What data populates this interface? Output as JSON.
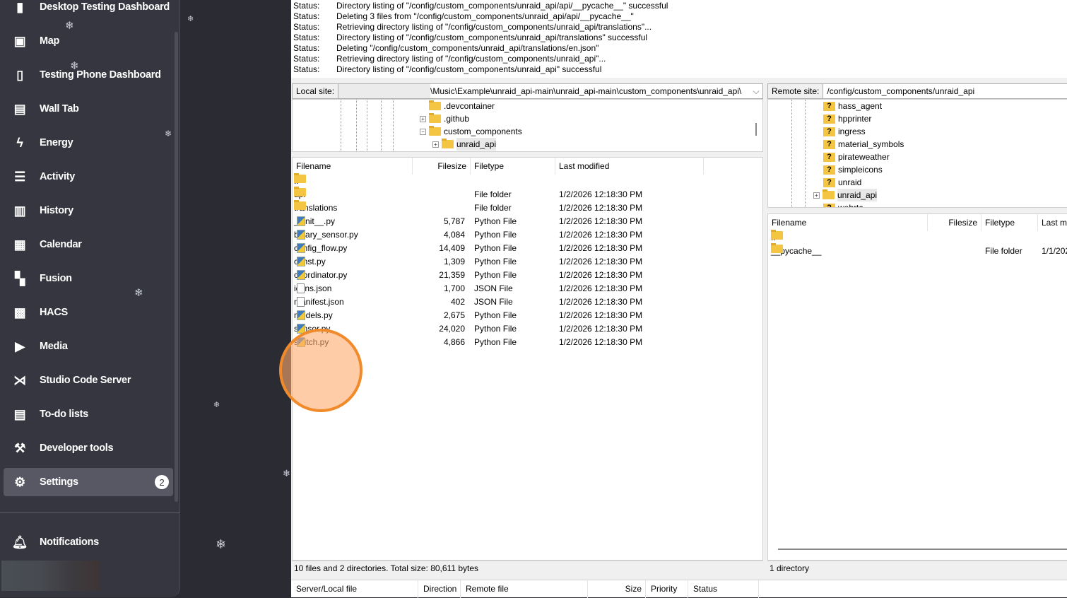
{
  "sidebar": {
    "items": [
      {
        "label": "Desktop Testing Dashboard",
        "icon": "test-tube-icon"
      },
      {
        "label": "Map",
        "icon": "map-account-icon"
      },
      {
        "label": "Testing Phone Dashboard",
        "icon": "phone-icon"
      },
      {
        "label": "Wall Tab",
        "icon": "newspaper-icon"
      },
      {
        "label": "Energy",
        "icon": "lightning-icon"
      },
      {
        "label": "Activity",
        "icon": "list-icon"
      },
      {
        "label": "History",
        "icon": "chart-box-icon"
      },
      {
        "label": "Calendar",
        "icon": "calendar-icon"
      },
      {
        "label": "Fusion",
        "icon": "dashboard-icon"
      },
      {
        "label": "HACS",
        "icon": "hacs-store-icon"
      },
      {
        "label": "Media",
        "icon": "play-box-icon"
      },
      {
        "label": "Studio Code Server",
        "icon": "vscode-icon"
      },
      {
        "label": "To-do lists",
        "icon": "clipboard-list-icon"
      },
      {
        "label": "Developer tools",
        "icon": "hammer-icon"
      },
      {
        "label": "Settings",
        "icon": "gear-icon",
        "badge": "2"
      }
    ],
    "notifications": "Notifications"
  },
  "log": [
    {
      "k": "Status:",
      "v": "Directory listing of \"/config/custom_components/unraid_api/api/__pycache__\" successful"
    },
    {
      "k": "Status:",
      "v": "Deleting 3 files from \"/config/custom_components/unraid_api/api/__pycache__\""
    },
    {
      "k": "Status:",
      "v": "Retrieving directory listing of \"/config/custom_components/unraid_api/translations\"..."
    },
    {
      "k": "Status:",
      "v": "Directory listing of \"/config/custom_components/unraid_api/translations\" successful"
    },
    {
      "k": "Status:",
      "v": "Deleting \"/config/custom_components/unraid_api/translations/en.json\""
    },
    {
      "k": "Status:",
      "v": "Retrieving directory listing of \"/config/custom_components/unraid_api\"..."
    },
    {
      "k": "Status:",
      "v": "Directory listing of \"/config/custom_components/unraid_api\" successful"
    }
  ],
  "local": {
    "label": "Local site:",
    "path": "\\Music\\Example\\unraid_api-main\\unraid_api-main\\custom_components\\unraid_api\\",
    "tree": [
      ".devcontainer",
      ".github",
      "custom_components",
      "unraid_api"
    ],
    "headers": [
      "Filename",
      "Filesize",
      "Filetype",
      "Last modified"
    ],
    "files": [
      {
        "name": "..",
        "size": "",
        "type": "",
        "mod": "",
        "kind": "folder"
      },
      {
        "name": "api",
        "size": "",
        "type": "File folder",
        "mod": "1/2/2026 12:18:30 PM",
        "kind": "folder"
      },
      {
        "name": "translations",
        "size": "",
        "type": "File folder",
        "mod": "1/2/2026 12:18:30 PM",
        "kind": "folder"
      },
      {
        "name": "__init__.py",
        "size": "5,787",
        "type": "Python File",
        "mod": "1/2/2026 12:18:30 PM",
        "kind": "py"
      },
      {
        "name": "binary_sensor.py",
        "size": "4,084",
        "type": "Python File",
        "mod": "1/2/2026 12:18:30 PM",
        "kind": "py"
      },
      {
        "name": "config_flow.py",
        "size": "14,409",
        "type": "Python File",
        "mod": "1/2/2026 12:18:30 PM",
        "kind": "py"
      },
      {
        "name": "const.py",
        "size": "1,309",
        "type": "Python File",
        "mod": "1/2/2026 12:18:30 PM",
        "kind": "py"
      },
      {
        "name": "coordinator.py",
        "size": "21,359",
        "type": "Python File",
        "mod": "1/2/2026 12:18:30 PM",
        "kind": "py"
      },
      {
        "name": "icons.json",
        "size": "1,700",
        "type": "JSON File",
        "mod": "1/2/2026 12:18:30 PM",
        "kind": "json"
      },
      {
        "name": "manifest.json",
        "size": "402",
        "type": "JSON File",
        "mod": "1/2/2026 12:18:30 PM",
        "kind": "json"
      },
      {
        "name": "models.py",
        "size": "2,675",
        "type": "Python File",
        "mod": "1/2/2026 12:18:30 PM",
        "kind": "py"
      },
      {
        "name": "sensor.py",
        "size": "24,020",
        "type": "Python File",
        "mod": "1/2/2026 12:18:30 PM",
        "kind": "py"
      },
      {
        "name": "switch.py",
        "size": "4,866",
        "type": "Python File",
        "mod": "1/2/2026 12:18:30 PM",
        "kind": "py"
      }
    ],
    "status": "10 files and 2 directories. Total size: 80,611 bytes"
  },
  "remote": {
    "label": "Remote site:",
    "path": "/config/custom_components/unraid_api",
    "tree": [
      "hass_agent",
      "hpprinter",
      "ingress",
      "material_symbols",
      "pirateweather",
      "simpleicons",
      "unraid",
      "unraid_api",
      "webrtc"
    ],
    "headers": [
      "Filename",
      "Filesize",
      "Filetype",
      "Last m"
    ],
    "files": [
      {
        "name": "..",
        "type": "",
        "mod": ""
      },
      {
        "name": "__pycache__",
        "type": "File folder",
        "mod": "1/1/202"
      }
    ],
    "status": "1 directory"
  },
  "queue": {
    "headers": [
      "Server/Local file",
      "Direction",
      "Remote file",
      "Size",
      "Priority",
      "Status"
    ]
  }
}
